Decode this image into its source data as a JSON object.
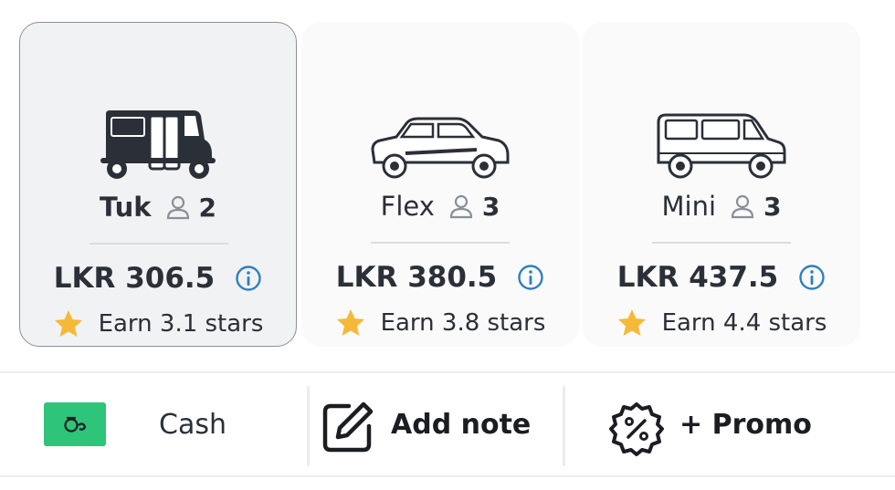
{
  "ride_options": [
    {
      "name": "Tuk",
      "seats": "2",
      "price": "LKR 306.5",
      "stars_text": "Earn 3.1 stars",
      "selected": true,
      "vehicle_icon": "tuk-tuk-icon"
    },
    {
      "name": "Flex",
      "seats": "3",
      "price": "LKR 380.5",
      "stars_text": "Earn 3.8 stars",
      "selected": false,
      "vehicle_icon": "hatchback-car-icon"
    },
    {
      "name": "Mini",
      "seats": "3",
      "price": "LKR 437.5",
      "stars_text": "Earn 4.4 stars",
      "selected": false,
      "vehicle_icon": "minivan-icon"
    }
  ],
  "bottom_bar": {
    "payment_label": "Cash",
    "note_label": "Add note",
    "promo_label": "+ Promo"
  },
  "colors": {
    "cash_green": "#2ec47a",
    "info_blue": "#2f7fc0",
    "star_yellow": "#f5b93a",
    "text_dark": "#2b2f38"
  },
  "icons": {
    "person": "person-icon",
    "info": "info-icon",
    "star": "star-icon",
    "cash": "cash-icon",
    "note": "edit-note-icon",
    "promo": "promo-badge-icon"
  }
}
